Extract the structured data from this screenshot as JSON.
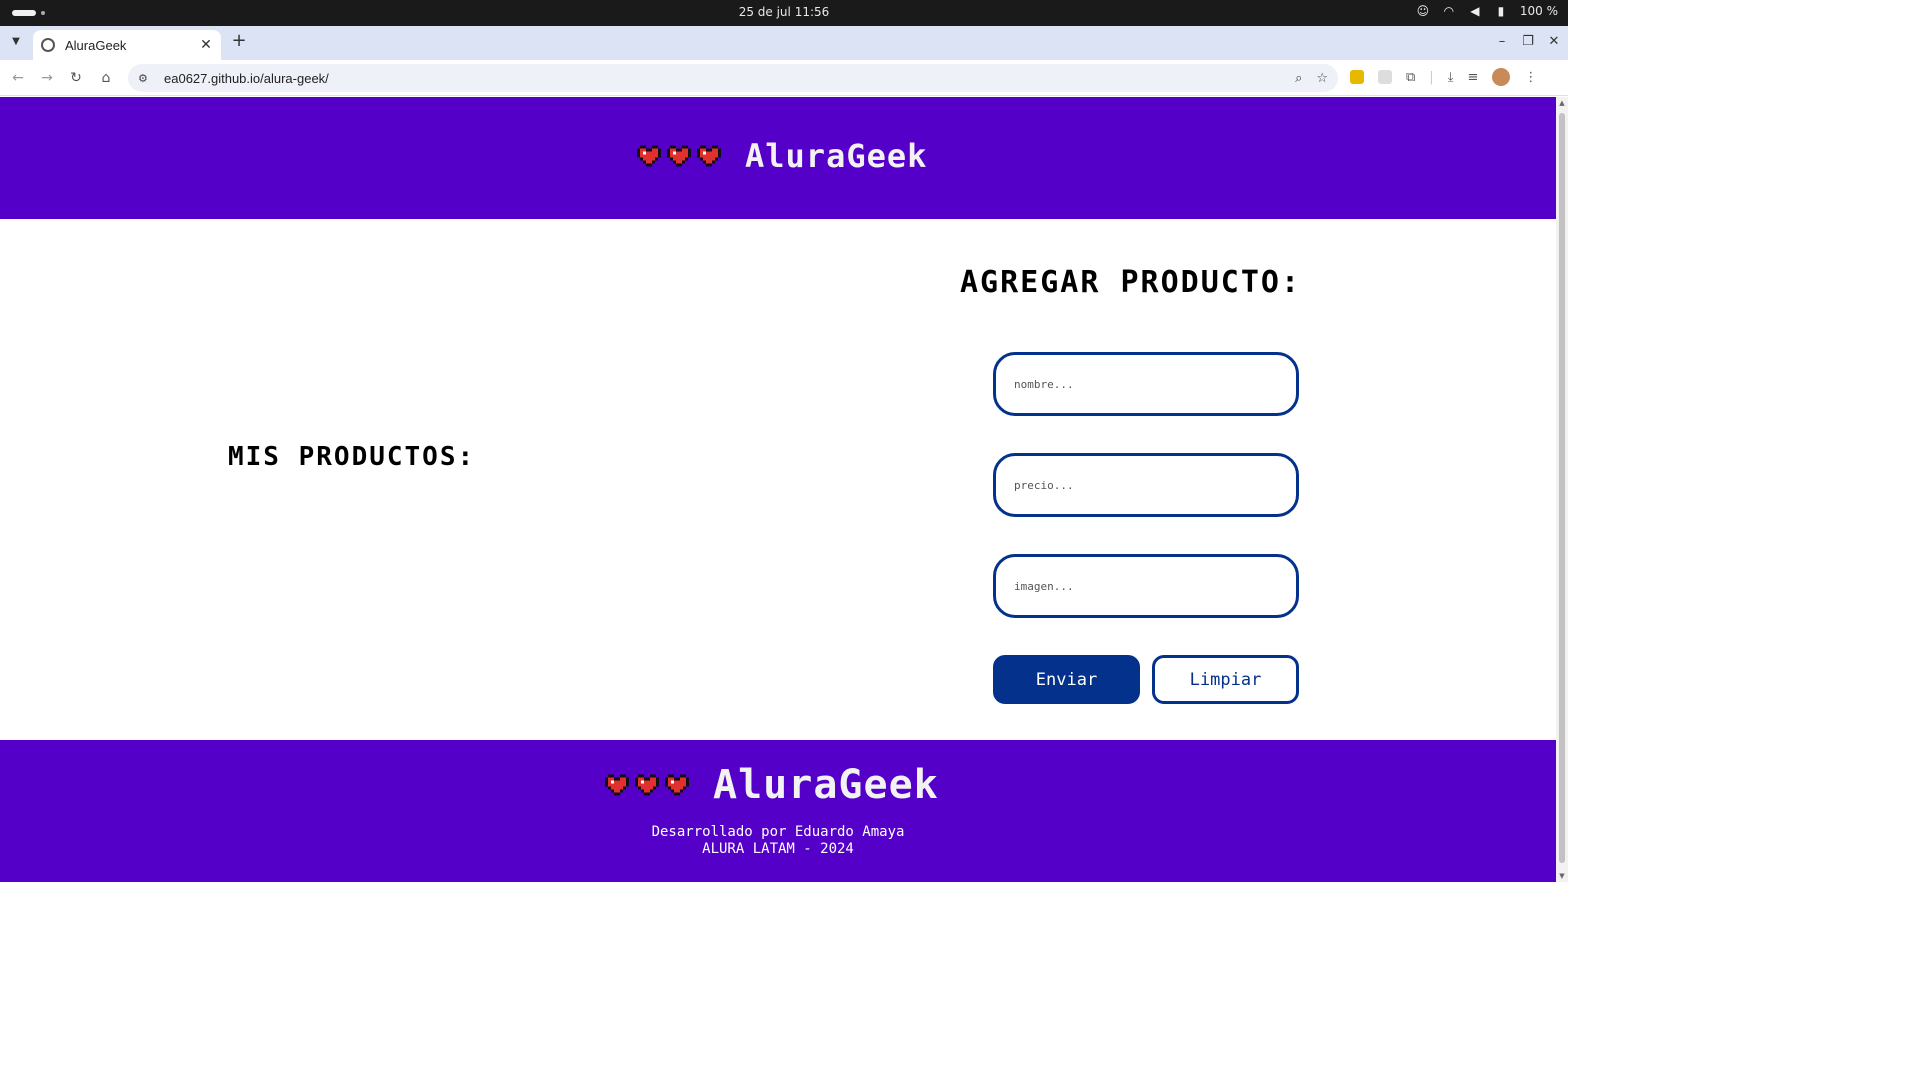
{
  "os": {
    "clock": "25 de jul  11:56",
    "battery": "100 %"
  },
  "browser": {
    "tab_title": "AluraGeek",
    "url": "ea0627.github.io/alura-geek/"
  },
  "header": {
    "brand": "AluraGeek"
  },
  "products": {
    "title": "MIS PRODUCTOS:"
  },
  "form": {
    "title": "AGREGAR PRODUCTO:",
    "name_placeholder": "nombre...",
    "price_placeholder": "precio...",
    "image_placeholder": "imagen...",
    "send_label": "Enviar",
    "clear_label": "Limpiar"
  },
  "footer": {
    "brand": "AluraGeek",
    "credit_line": "Desarrollado por Eduardo Amaya",
    "copyright": "ALURA LATAM - 2024"
  },
  "colors": {
    "brand_purple": "#5400c8",
    "primary_blue": "#03318c",
    "heart_red": "#e03030"
  },
  "icons": [
    "pixel-heart-icon",
    "search-icon",
    "star-icon",
    "download-icon",
    "extensions-icon"
  ]
}
